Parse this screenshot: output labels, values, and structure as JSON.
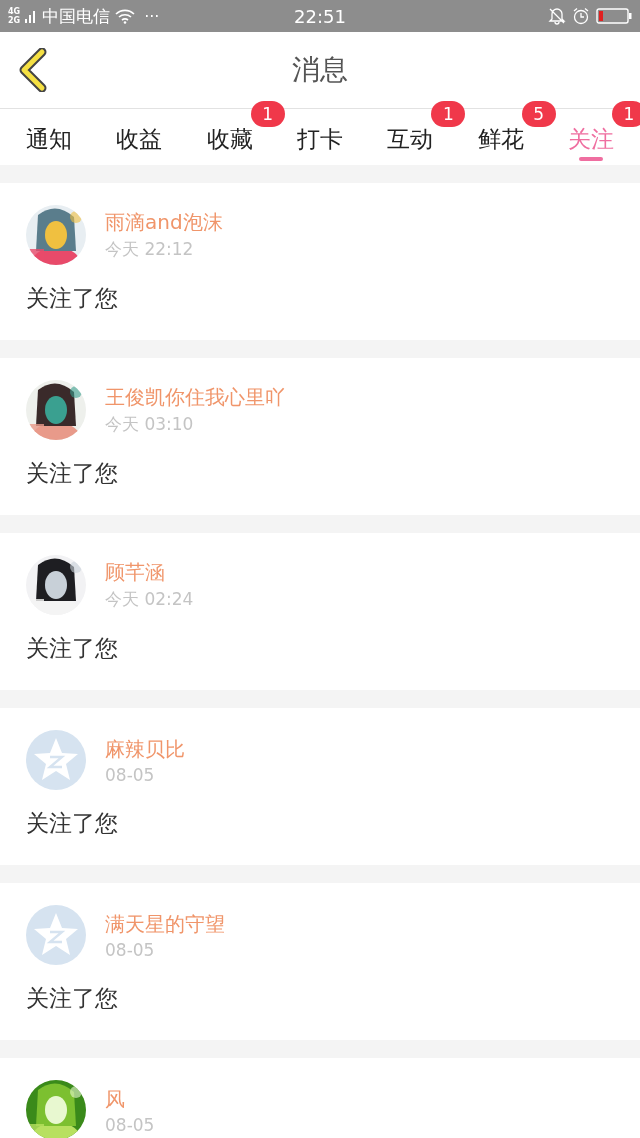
{
  "status_bar": {
    "network_top": "4G",
    "network_bottom": "2G",
    "carrier": "中国电信",
    "more": "···",
    "time": "22:51"
  },
  "header": {
    "title": "消息"
  },
  "tabs": [
    {
      "label": "通知",
      "selected": false
    },
    {
      "label": "收益",
      "selected": false
    },
    {
      "label": "收藏",
      "selected": false,
      "badge": "1"
    },
    {
      "label": "打卡",
      "selected": false
    },
    {
      "label": "互动",
      "selected": false,
      "badge": "1"
    },
    {
      "label": "鲜花",
      "selected": false,
      "badge": "5"
    },
    {
      "label": "关注",
      "selected": true,
      "badge": "1"
    }
  ],
  "messages": [
    {
      "name": "雨滴and泡沫",
      "time": "今天 22:12",
      "text": "关注了您",
      "default_avatar": false
    },
    {
      "name": "王俊凯你住我心里吖",
      "time": "今天 03:10",
      "text": "关注了您",
      "default_avatar": false
    },
    {
      "name": "顾芊涵",
      "time": "今天 02:24",
      "text": "关注了您",
      "default_avatar": false
    },
    {
      "name": "麻辣贝比",
      "time": "08-05",
      "text": "关注了您",
      "default_avatar": true
    },
    {
      "name": "满天星的守望",
      "time": "08-05",
      "text": "关注了您",
      "default_avatar": true
    },
    {
      "name": "风",
      "time": "08-05",
      "default_avatar": false
    }
  ]
}
